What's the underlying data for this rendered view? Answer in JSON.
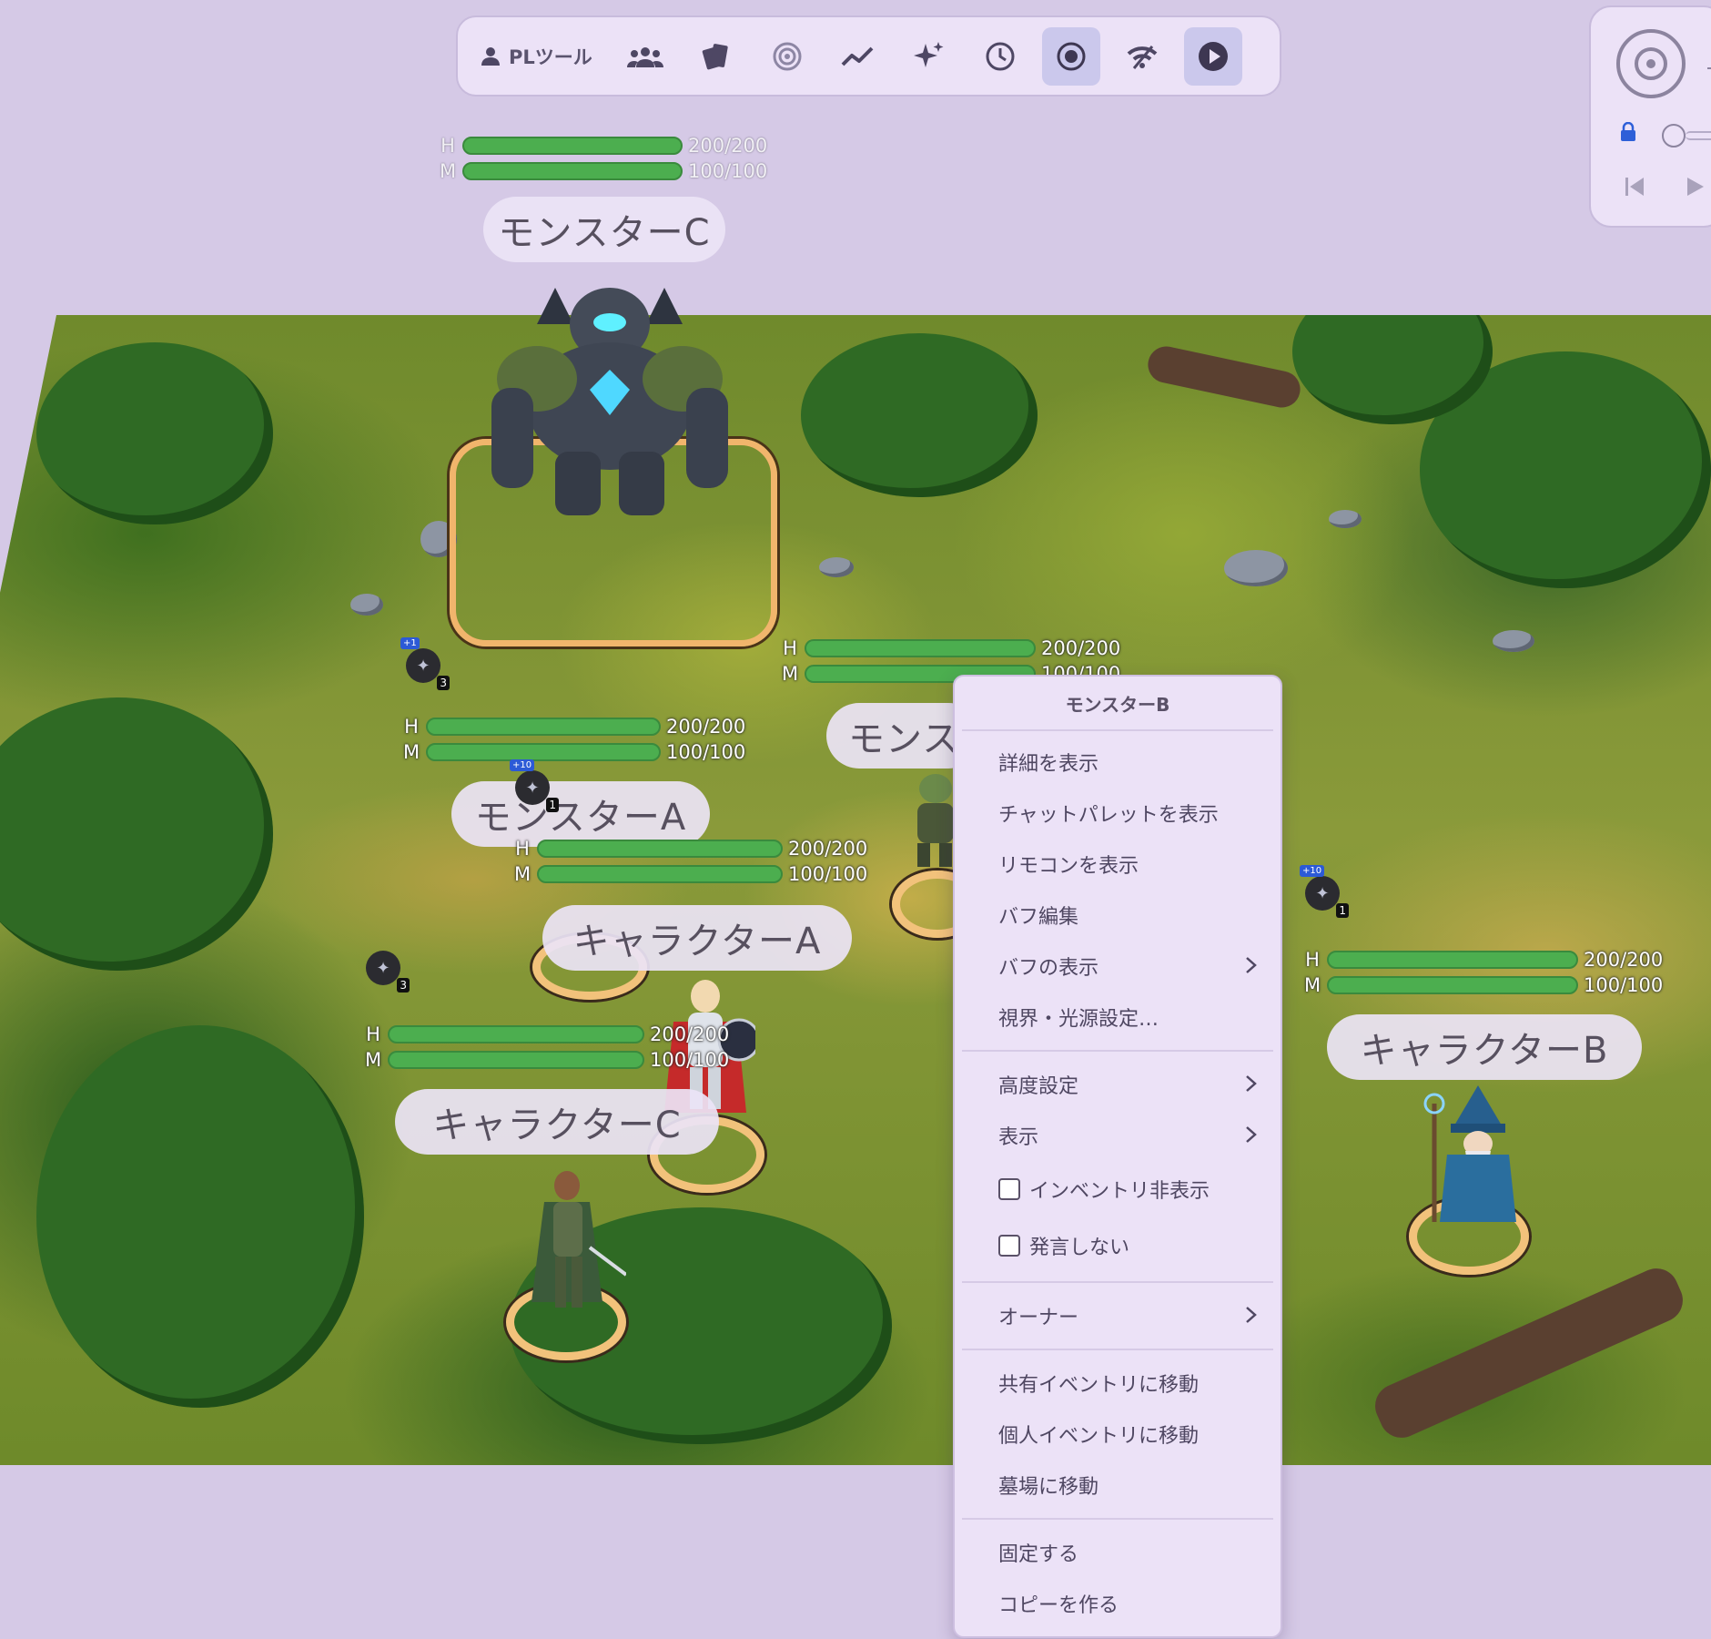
{
  "toolbar": {
    "pl_tools_label": "PLツール",
    "icons": [
      "person-icon",
      "group-icon",
      "cards-icon",
      "target-icon",
      "chart-line-icon",
      "sparkle-icon",
      "clock-icon",
      "record-icon",
      "signal-icon",
      "play-icon"
    ]
  },
  "side_panel": {
    "icons": [
      "disc-icon",
      "lock-icon",
      "slider-handle",
      "skip-back-icon",
      "play-icon"
    ]
  },
  "tokens": [
    {
      "name": "モンスターC",
      "hp": "200/200",
      "mp": "100/100"
    },
    {
      "name": "モンスターA",
      "hp": "200/200",
      "mp": "100/100"
    },
    {
      "name": "モンスターB",
      "hp": "200/200",
      "mp": "100/100",
      "name_visible": "モンス"
    },
    {
      "name": "キャラクターA",
      "hp": "200/200",
      "mp": "100/100"
    },
    {
      "name": "キャラクターB",
      "hp": "200/200",
      "mp": "100/100"
    },
    {
      "name": "キャラクターC",
      "hp": "200/200",
      "mp": "100/100"
    }
  ],
  "stat_labels": {
    "hp": "H",
    "mp": "M"
  },
  "buffs": [
    {
      "plus": "+1",
      "count": "3"
    },
    {
      "plus": "+10",
      "count": "1"
    },
    {
      "plus": "",
      "count": "3"
    },
    {
      "plus": "+10",
      "count": "1"
    }
  ],
  "context_menu": {
    "title": "モンスターB",
    "items": [
      "詳細を表示",
      "チャットパレットを表示",
      "リモコンを表示",
      "バフ編集",
      "バフの表示",
      "視界・光源設定…",
      "高度設定",
      "表示",
      "インベントリ非表示",
      "発言しない",
      "オーナー",
      "共有イベントリに移動",
      "個人イベントリに移動",
      "墓場に移動",
      "固定する",
      "コピーを作る"
    ]
  },
  "colors": {
    "background": "#d5c9e6",
    "panel": "#ece2f7",
    "hp_bar": "#4cae4f",
    "ring": "#f2c27b",
    "active_button": "#cbc8ec"
  }
}
